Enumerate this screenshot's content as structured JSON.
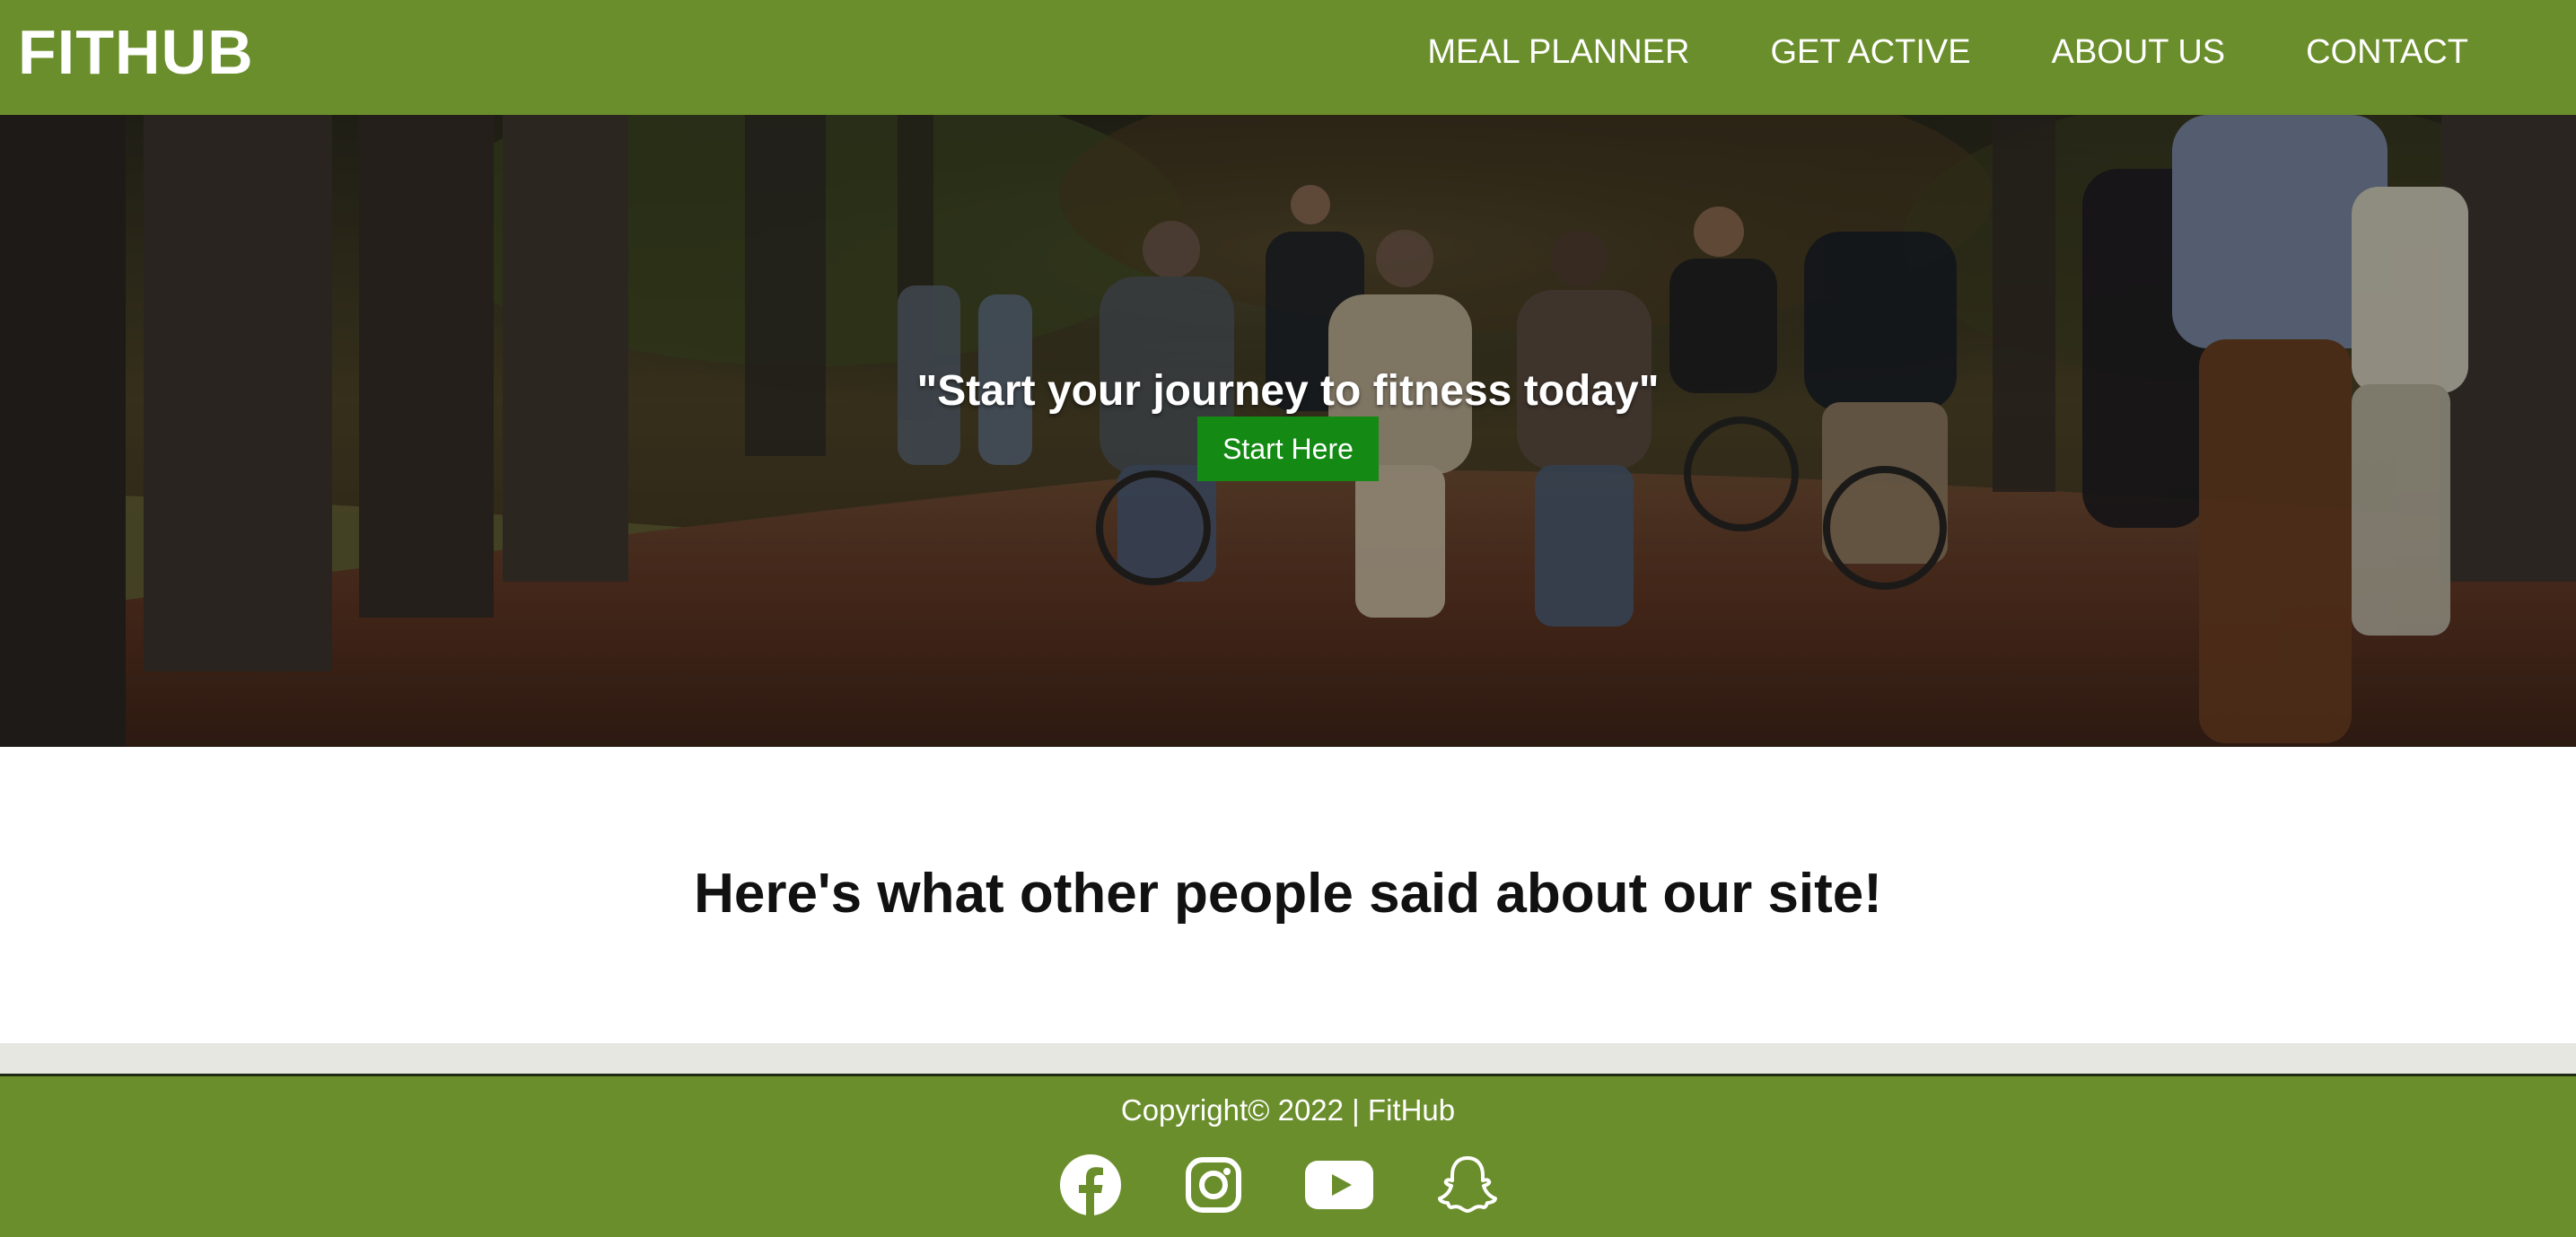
{
  "brand": {
    "logo": "FITHUB",
    "primary_color": "#6b8e2c",
    "button_color": "#148a14"
  },
  "nav": {
    "items": [
      "MEAL PLANNER",
      "GET ACTIVE",
      "ABOUT US",
      "CONTACT"
    ]
  },
  "hero": {
    "quote": "\"Start your journey to fitness today\"",
    "button_label": "Start Here"
  },
  "testimonials": {
    "heading": "Here's what other people said about our site!"
  },
  "footer": {
    "copyright": "Copyright© 2022 | FitHub",
    "socials": [
      "facebook-icon",
      "instagram-icon",
      "youtube-icon",
      "snapchat-icon"
    ]
  }
}
